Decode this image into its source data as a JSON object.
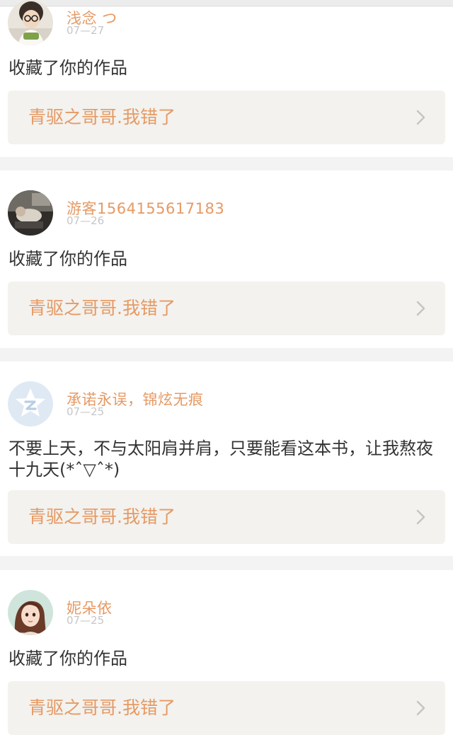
{
  "feed": [
    {
      "username": "浅念 つ",
      "date": "07—27",
      "message": "收藏了你的作品",
      "work_title": "青驱之哥哥.我错了",
      "avatar": "user-photo-glasses"
    },
    {
      "username": "游客1564155617183",
      "date": "07—26",
      "message": "收藏了你的作品",
      "work_title": "青驱之哥哥.我错了",
      "avatar": "user-photo-dark"
    },
    {
      "username": "承诺永误，锦炫无痕",
      "date": "07—25",
      "message": "不要上天，不与太阳肩并肩，只要能看这本书，让我熬夜十九天(*ˆ▽ˆ*)",
      "work_title": "青驱之哥哥.我错了",
      "avatar": "default-star-avatar"
    },
    {
      "username": "妮朵依",
      "date": "07—25",
      "message": "收藏了你的作品",
      "work_title": "青驱之哥哥.我错了",
      "avatar": "user-illustration-girl"
    }
  ],
  "colors": {
    "username": "#e59a65",
    "work_title": "#e59a65",
    "date": "#c6c6c6",
    "card_bg": "#ffffff",
    "page_bg": "#f3f3f3",
    "work_bg": "#f3f2ee"
  }
}
